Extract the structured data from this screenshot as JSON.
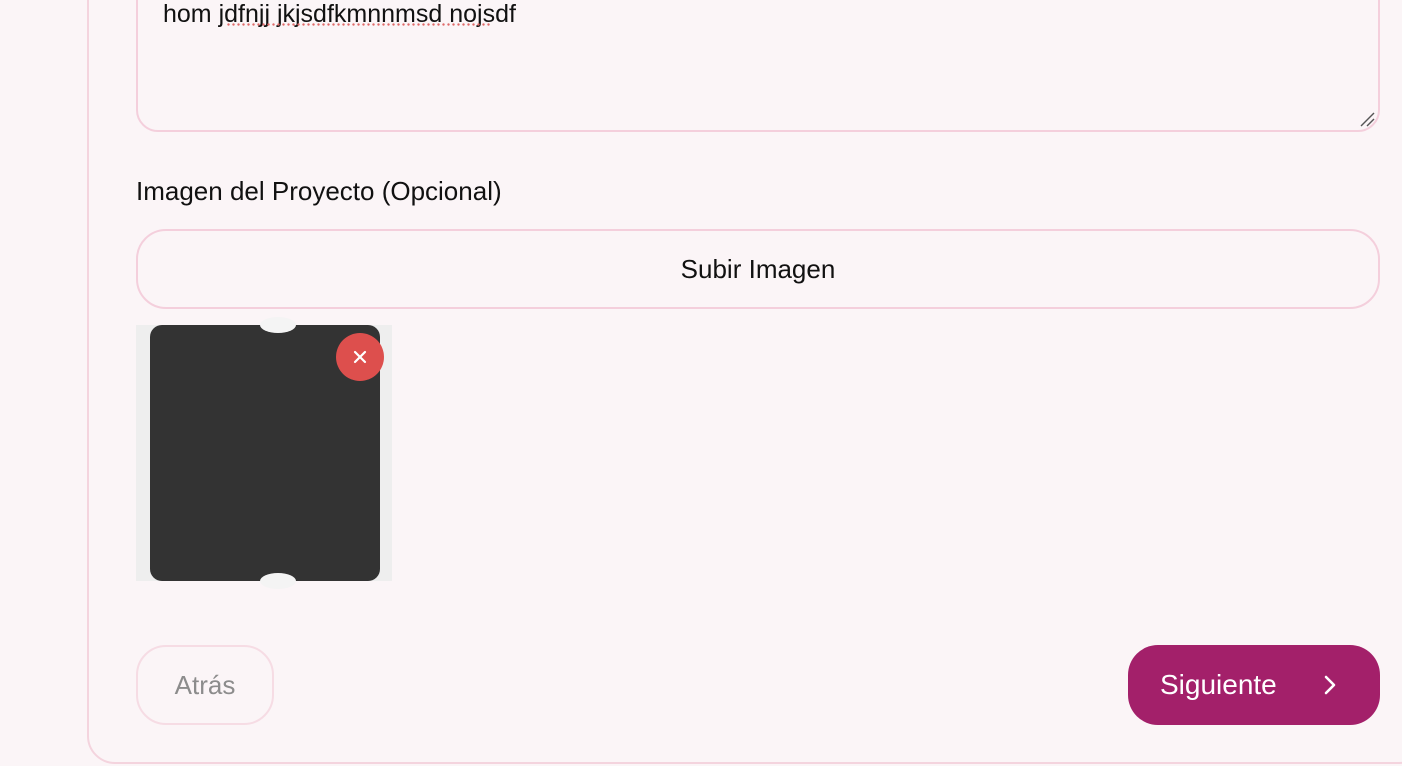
{
  "form": {
    "description_value": "hom jdfnjj jkjsdfkmnnmsd nojsdf",
    "image_label": "Imagen del Proyecto (Opcional)",
    "upload_button_label": "Subir Imagen",
    "back_button_label": "Atrás",
    "next_button_label": "Siguiente"
  },
  "icons": {
    "remove": "close-icon",
    "next": "chevron-right-icon",
    "resize": "resize-grip-icon"
  },
  "colors": {
    "page_bg": "#fbf5f7",
    "border": "#f4cfdc",
    "primary": "#a3206a",
    "danger": "#dd4f4d",
    "muted_text": "#8c8c8c"
  }
}
